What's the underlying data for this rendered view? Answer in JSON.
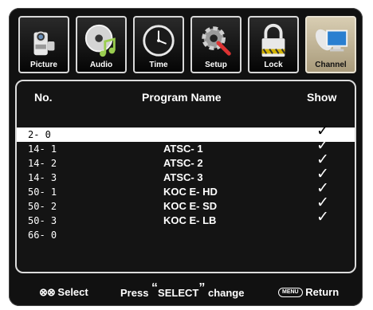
{
  "tabs": [
    {
      "label": "Picture",
      "icon": "camera-icon",
      "active": false
    },
    {
      "label": "Audio",
      "icon": "music-disc-icon",
      "active": false
    },
    {
      "label": "Time",
      "icon": "clock-icon",
      "active": false
    },
    {
      "label": "Setup",
      "icon": "tools-icon",
      "active": false
    },
    {
      "label": "Lock",
      "icon": "padlock-icon",
      "active": false
    },
    {
      "label": "Channel",
      "icon": "satellite-dish-icon",
      "active": true
    }
  ],
  "table": {
    "headers": {
      "no": "No.",
      "name": "Program Name",
      "show": "Show"
    },
    "rows": [
      {
        "no": "2- 0",
        "name": "",
        "show": "✓",
        "selected": true
      },
      {
        "no": "14- 1",
        "name": "ATSC- 1",
        "show": "✓",
        "selected": false
      },
      {
        "no": "14- 2",
        "name": "ATSC- 2",
        "show": "✓",
        "selected": false
      },
      {
        "no": "14- 3",
        "name": "ATSC- 3",
        "show": "✓",
        "selected": false
      },
      {
        "no": "50- 1",
        "name": "KOC E- HD",
        "show": "✓",
        "selected": false
      },
      {
        "no": "50- 2",
        "name": "KOC E- SD",
        "show": "✓",
        "selected": false
      },
      {
        "no": "50- 3",
        "name": "KOC E- LB",
        "show": "✓",
        "selected": false
      },
      {
        "no": "66- 0",
        "name": "",
        "show": "",
        "selected": false
      }
    ]
  },
  "footer": {
    "select_label": "Select",
    "press_label": "Press",
    "select_key": "SELECT",
    "change_label": "change",
    "menu_key": "MENU",
    "return_label": "Return"
  },
  "colors": {
    "background": "#111111",
    "active_tab": "#c8bc9e",
    "border": "#dcdcdc",
    "selected_row": "#ffffff"
  }
}
